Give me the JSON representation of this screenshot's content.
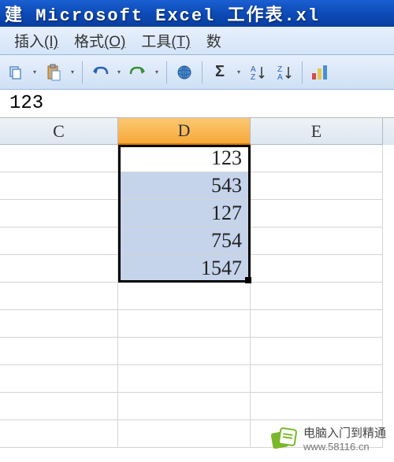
{
  "titlebar": {
    "prefix": "建",
    "title": "Microsoft Excel 工作表.xl"
  },
  "menu": {
    "insert": "插入",
    "insert_key": "(I)",
    "format": "格式",
    "format_key": "(O)",
    "tools": "工具",
    "tools_key": "(T)",
    "data": "数"
  },
  "formula_bar": {
    "value": "123"
  },
  "columns": {
    "c": "C",
    "d": "D",
    "e": "E"
  },
  "chart_data": {
    "type": "table",
    "title": "",
    "columns": [
      "C",
      "D",
      "E"
    ],
    "rows": [
      {
        "C": "",
        "D": 123,
        "E": ""
      },
      {
        "C": "",
        "D": 543,
        "E": ""
      },
      {
        "C": "",
        "D": 127,
        "E": ""
      },
      {
        "C": "",
        "D": 754,
        "E": ""
      },
      {
        "C": "",
        "D": 1547,
        "E": ""
      }
    ]
  },
  "cells": {
    "d1": "123",
    "d2": "543",
    "d3": "127",
    "d4": "754",
    "d5": "1547"
  },
  "watermark": {
    "text": "电脑入门到精通",
    "site": "www.58116.cn"
  },
  "toolbar": {
    "sigma": "Σ"
  }
}
